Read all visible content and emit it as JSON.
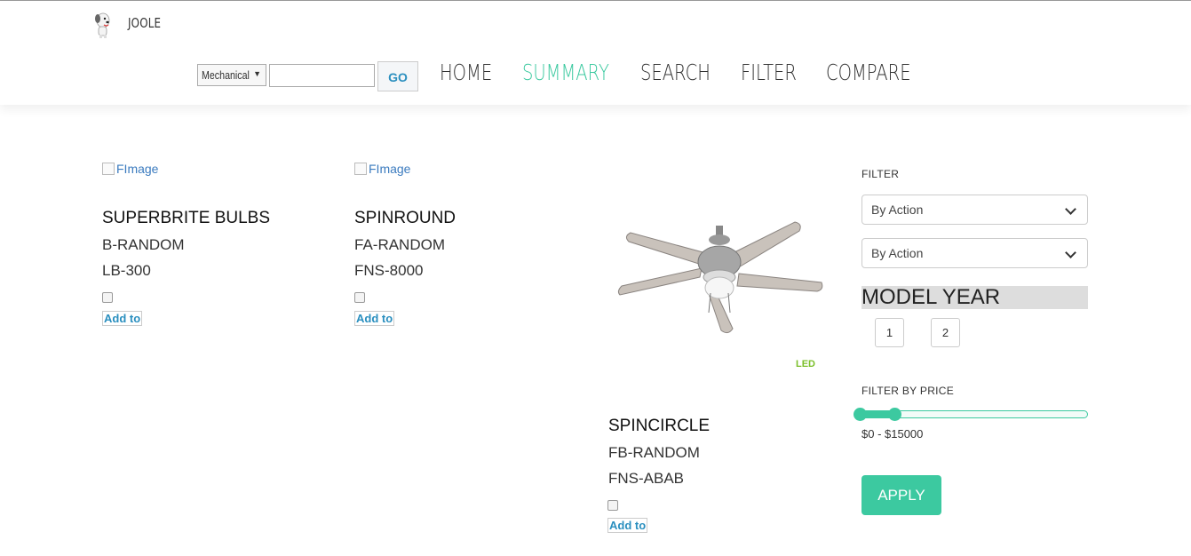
{
  "header": {
    "brand": "JOOLE",
    "category_select": "Mechanical",
    "search_value": "",
    "go_label": "GO",
    "nav": [
      "HOME",
      "SUMMARY",
      "SEARCH",
      "FILTER",
      "COMPARE"
    ],
    "active_nav": "SUMMARY"
  },
  "products": [
    {
      "image_alt": "FImage",
      "name": "SUPERBRITE BULBS",
      "line1": "B-RANDOM",
      "line2": "LB-300",
      "add_label": "Add to"
    },
    {
      "image_alt": "FImage",
      "name": "SPINROUND",
      "line1": "FA-RANDOM",
      "line2": "FNS-8000",
      "add_label": "Add to"
    },
    {
      "image": "ceiling-fan",
      "badge": "LED",
      "name": "SPINCIRCLE",
      "line1": "FB-RANDOM",
      "line2": "FNS-ABAB",
      "add_label": "Add to"
    }
  ],
  "filter": {
    "title": "FILTER",
    "dropdown1": "By Action",
    "dropdown2": "By Action",
    "model_year_title": "MODEL YEAR",
    "year_buttons": [
      "1",
      "2"
    ],
    "price_title": "FILTER BY PRICE",
    "price_range": "$0 - $15000",
    "apply_label": "APPLY",
    "accent": "#3cc9a0"
  }
}
